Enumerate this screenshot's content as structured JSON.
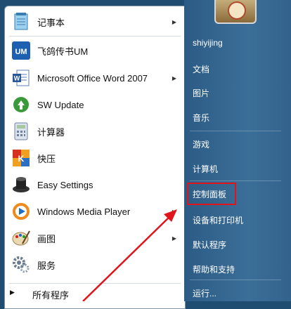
{
  "programs": [
    {
      "label": "记事本",
      "icon": "notepad-icon",
      "has_submenu": true
    },
    {
      "label": "飞鸽传书UM",
      "icon": "um-icon",
      "has_submenu": false
    },
    {
      "label": "Microsoft Office Word 2007",
      "icon": "word-icon",
      "has_submenu": true
    },
    {
      "label": "SW Update",
      "icon": "update-icon",
      "has_submenu": false
    },
    {
      "label": "计算器",
      "icon": "calculator-icon",
      "has_submenu": false
    },
    {
      "label": "快压",
      "icon": "kuaiya-icon",
      "has_submenu": false
    },
    {
      "label": "Easy Settings",
      "icon": "settings-icon",
      "has_submenu": false
    },
    {
      "label": "Windows Media Player",
      "icon": "media-player-icon",
      "has_submenu": true
    },
    {
      "label": "画图",
      "icon": "paint-icon",
      "has_submenu": true
    },
    {
      "label": "服务",
      "icon": "services-icon",
      "has_submenu": false
    }
  ],
  "all_programs_label": "所有程序",
  "um_icon_text": "UM",
  "right_items": [
    "shiyijing",
    "文档",
    "图片",
    "音乐",
    "游戏",
    "计算机",
    "控制面板",
    "设备和打印机",
    "默认程序",
    "帮助和支持",
    "运行..."
  ],
  "highlighted_item": "控制面板",
  "colors": {
    "highlight": "#e0151b",
    "panel_blue": "#33638c"
  }
}
